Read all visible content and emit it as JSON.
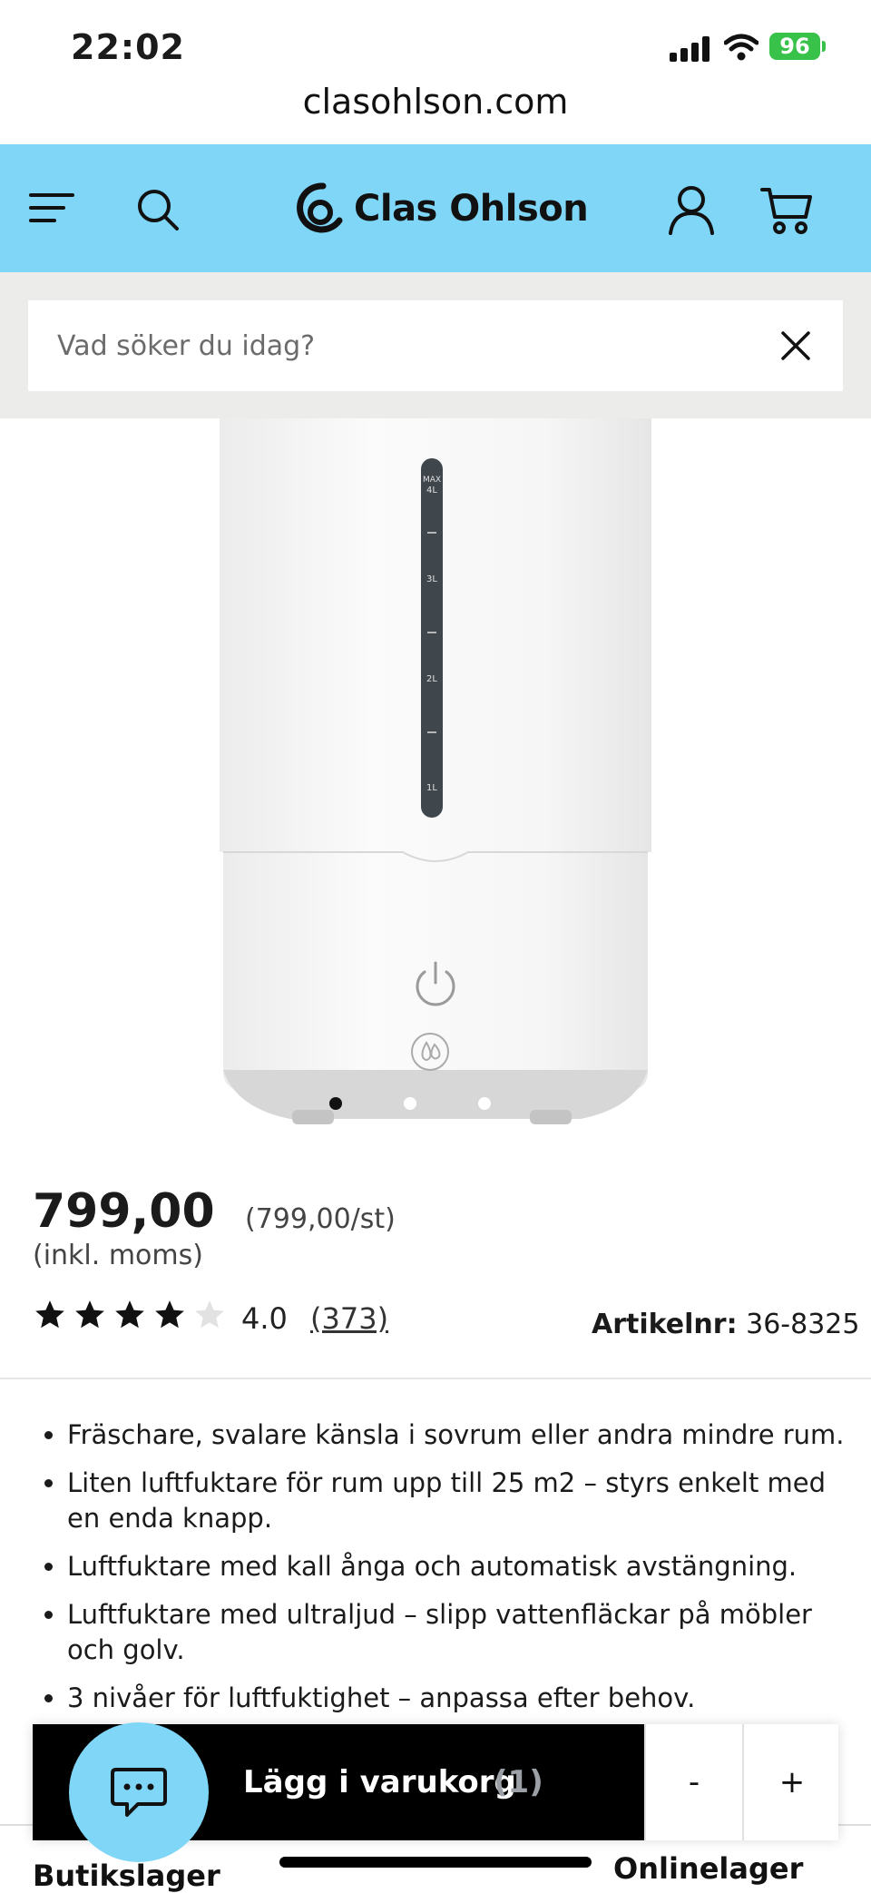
{
  "status_bar": {
    "time": "22:02",
    "battery": "96"
  },
  "browser": {
    "url": "clasohlson.com"
  },
  "header": {
    "brand": "Clas Ohlson",
    "icons": [
      "menu-icon",
      "search-icon",
      "user-icon",
      "cart-icon"
    ],
    "background_color": "#7fd6f7"
  },
  "search": {
    "placeholder": "Vad söker du idag?",
    "value": ""
  },
  "product": {
    "image_labels": {
      "max": "MAX",
      "l4": "4L",
      "l3": "3L",
      "l2": "2L",
      "l1": "1L"
    },
    "carousel": {
      "active_index": 0,
      "count": 3
    },
    "price": "799,00",
    "unit_price": "(799,00/st)",
    "vat_note": "(inkl. moms)",
    "rating": {
      "value": "4.0",
      "stars": 4,
      "max_stars": 5,
      "count": "(373)"
    },
    "article_label": "Artikelnr:",
    "article_number": "36-8325",
    "bullets": [
      "Fräschare, svalare känsla i sovrum eller andra mindre rum.",
      "Liten luftfuktare för rum upp till 25 m2 – styrs enkelt med en enda knapp.",
      "Luftfuktare med kall ånga och automatisk avstängning.",
      "Luftfuktare med ultraljud – slipp vattenfläckar på möbler och golv.",
      "3 nivåer för luftfuktighet – anpassa efter behov."
    ]
  },
  "buy_bar": {
    "add_to_cart": "Lägg i varukorg",
    "count": "(1)",
    "decrease": "-",
    "increase": "+"
  },
  "bottom": {
    "store_stock": "Butikslager",
    "online_stock": "Onlinelager"
  }
}
